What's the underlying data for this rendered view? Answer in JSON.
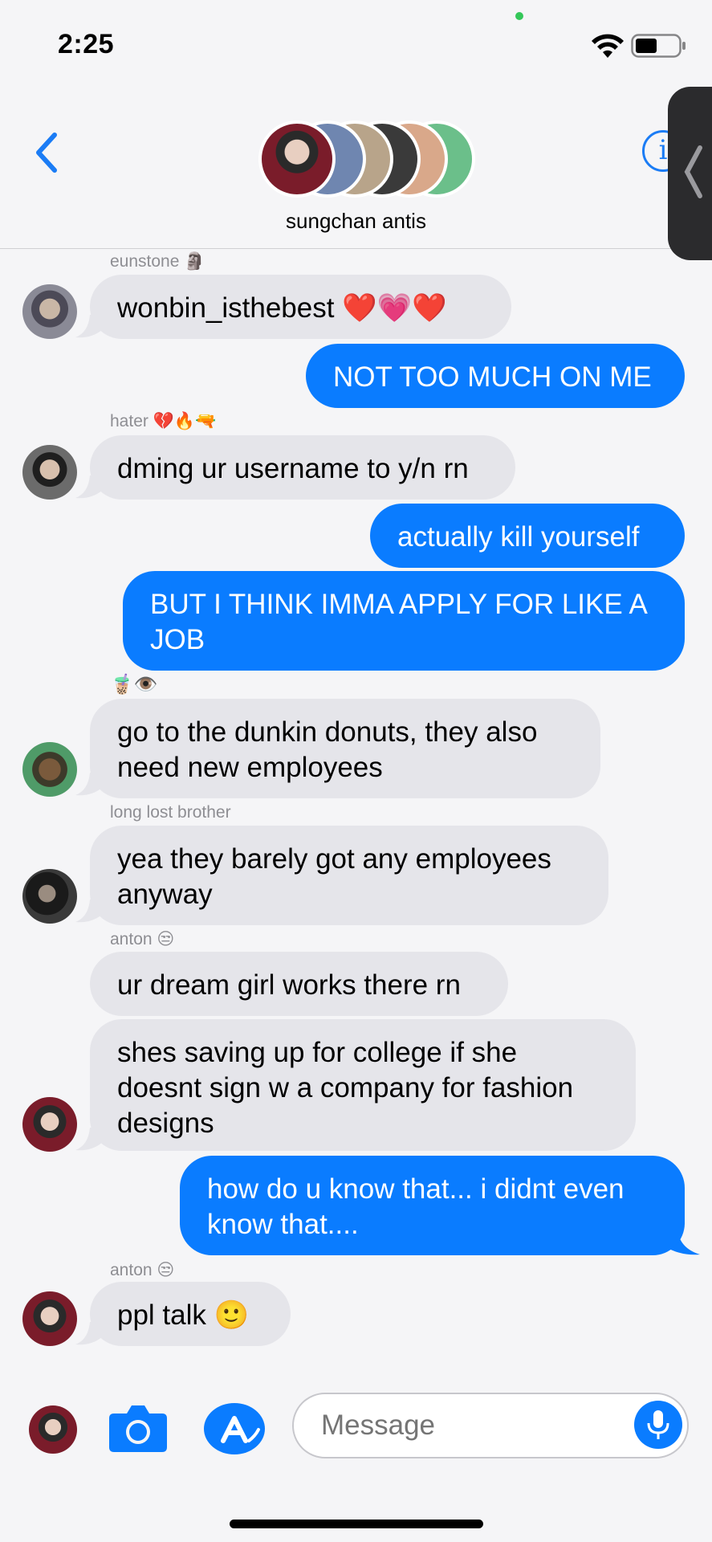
{
  "status_bar": {
    "time": "2:25"
  },
  "header": {
    "group_name": "sungchan antis",
    "info_icon": "i"
  },
  "messages": [
    {
      "sender": "eunstone 🗿",
      "text": "wonbin_isthebest ❤️💗❤️"
    },
    {
      "text": "NOT TOO MUCH ON ME"
    },
    {
      "sender": "hater 💔🔥🔫",
      "text": "dming ur username to y/n rn"
    },
    {
      "text": "actually kill yourself"
    },
    {
      "text": "BUT I THINK IMMA APPLY FOR LIKE A JOB"
    },
    {
      "sender": "🧋👁️",
      "text": "go to the dunkin donuts, they also need new employees"
    },
    {
      "sender": "long lost brother",
      "text": "yea they barely got any employees anyway"
    },
    {
      "sender": "anton 😒",
      "text": "ur dream girl works there rn"
    },
    {
      "text": "shes saving up for college if she doesnt sign w a company for fashion designs"
    },
    {
      "text": "how do u know that... i didnt even know that...."
    },
    {
      "sender": "anton 😒",
      "text": "ppl talk 🙂"
    }
  ],
  "composer": {
    "placeholder": "Message"
  },
  "icons": {
    "back": "chevron-left-icon",
    "info": "info-icon",
    "camera": "camera-icon",
    "apps": "app-store-icon",
    "mic": "microphone-icon"
  },
  "colors": {
    "accent": "#0a7cff",
    "incoming": "#e5e5ea",
    "background": "#f5f5f7"
  }
}
